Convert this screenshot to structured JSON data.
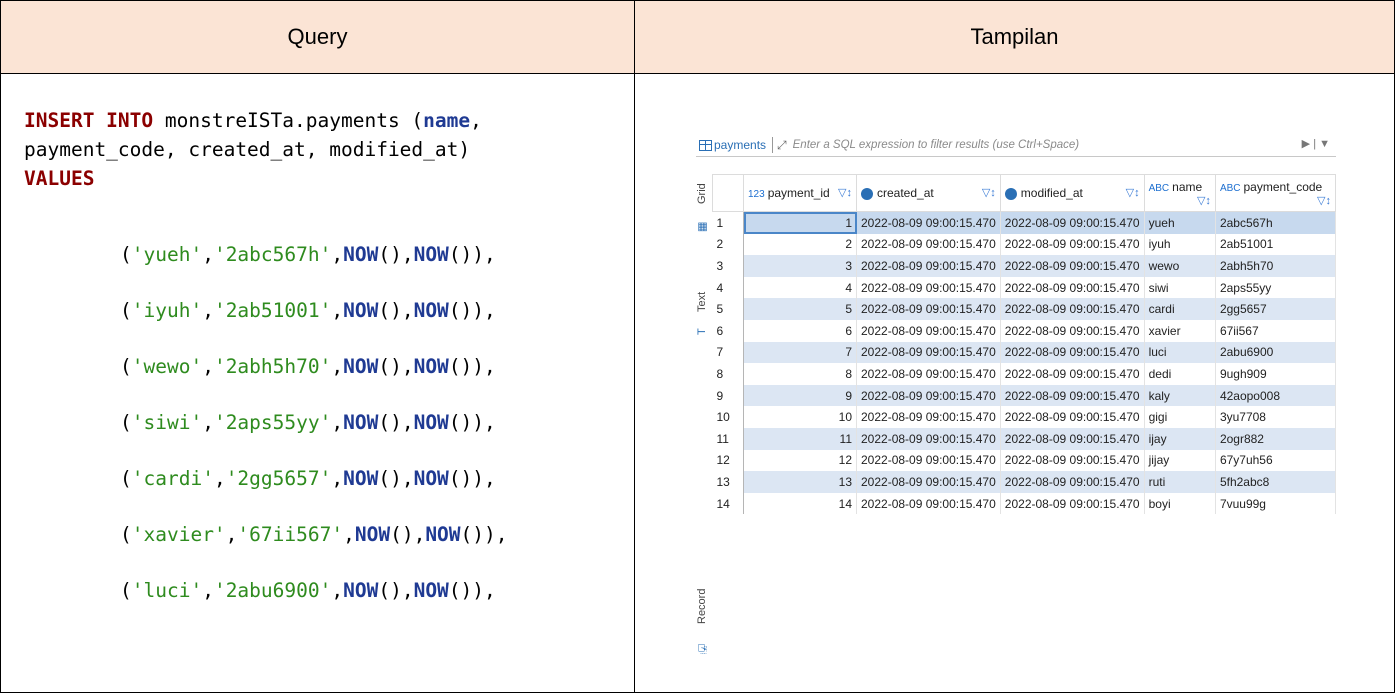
{
  "header": {
    "query": "Query",
    "tampilan": "Tampilan"
  },
  "sql": {
    "line1_kw": "INSERT INTO",
    "line1_rest": " monstreISTa.payments (",
    "line1_name": "name",
    "line1_end": ",",
    "line2": "payment_code, created_at, modified_at)",
    "line3_kw": "VALUES",
    "fn": "NOW",
    "values": [
      {
        "name": "yueh",
        "code": "2abc567h"
      },
      {
        "name": "iyuh",
        "code": "2ab51001"
      },
      {
        "name": "wewo",
        "code": "2abh5h70"
      },
      {
        "name": "siwi",
        "code": "2aps55yy"
      },
      {
        "name": "cardi",
        "code": "2gg5657"
      },
      {
        "name": "xavier",
        "code": "67ii567"
      },
      {
        "name": "luci",
        "code": "2abu6900"
      }
    ]
  },
  "panel": {
    "table_name": "payments",
    "filter_placeholder": "Enter a SQL expression to filter results (use Ctrl+Space)",
    "side_tabs": [
      "Grid",
      "Text",
      "Record"
    ],
    "columns": [
      "payment_id",
      "created_at",
      "modified_at",
      "name",
      "payment_code"
    ],
    "rows": [
      {
        "rn": "1",
        "id": "1",
        "created": "2022-08-09 09:00:15.470",
        "modified": "2022-08-09 09:00:15.470",
        "name": "yueh",
        "code": "2abc567h"
      },
      {
        "rn": "2",
        "id": "2",
        "created": "2022-08-09 09:00:15.470",
        "modified": "2022-08-09 09:00:15.470",
        "name": "iyuh",
        "code": "2ab51001"
      },
      {
        "rn": "3",
        "id": "3",
        "created": "2022-08-09 09:00:15.470",
        "modified": "2022-08-09 09:00:15.470",
        "name": "wewo",
        "code": "2abh5h70"
      },
      {
        "rn": "4",
        "id": "4",
        "created": "2022-08-09 09:00:15.470",
        "modified": "2022-08-09 09:00:15.470",
        "name": "siwi",
        "code": "2aps55yy"
      },
      {
        "rn": "5",
        "id": "5",
        "created": "2022-08-09 09:00:15.470",
        "modified": "2022-08-09 09:00:15.470",
        "name": "cardi",
        "code": "2gg5657"
      },
      {
        "rn": "6",
        "id": "6",
        "created": "2022-08-09 09:00:15.470",
        "modified": "2022-08-09 09:00:15.470",
        "name": "xavier",
        "code": "67ii567"
      },
      {
        "rn": "7",
        "id": "7",
        "created": "2022-08-09 09:00:15.470",
        "modified": "2022-08-09 09:00:15.470",
        "name": "luci",
        "code": "2abu6900"
      },
      {
        "rn": "8",
        "id": "8",
        "created": "2022-08-09 09:00:15.470",
        "modified": "2022-08-09 09:00:15.470",
        "name": "dedi",
        "code": "9ugh909"
      },
      {
        "rn": "9",
        "id": "9",
        "created": "2022-08-09 09:00:15.470",
        "modified": "2022-08-09 09:00:15.470",
        "name": "kaly",
        "code": "42aopo008"
      },
      {
        "rn": "10",
        "id": "10",
        "created": "2022-08-09 09:00:15.470",
        "modified": "2022-08-09 09:00:15.470",
        "name": "gigi",
        "code": "3yu7708"
      },
      {
        "rn": "11",
        "id": "11",
        "created": "2022-08-09 09:00:15.470",
        "modified": "2022-08-09 09:00:15.470",
        "name": "ijay",
        "code": "2ogr882"
      },
      {
        "rn": "12",
        "id": "12",
        "created": "2022-08-09 09:00:15.470",
        "modified": "2022-08-09 09:00:15.470",
        "name": "jijay",
        "code": "67y7uh56"
      },
      {
        "rn": "13",
        "id": "13",
        "created": "2022-08-09 09:00:15.470",
        "modified": "2022-08-09 09:00:15.470",
        "name": "ruti",
        "code": "5fh2abc8"
      },
      {
        "rn": "14",
        "id": "14",
        "created": "2022-08-09 09:00:15.470",
        "modified": "2022-08-09 09:00:15.470",
        "name": "boyi",
        "code": "7vuu99g"
      }
    ]
  }
}
